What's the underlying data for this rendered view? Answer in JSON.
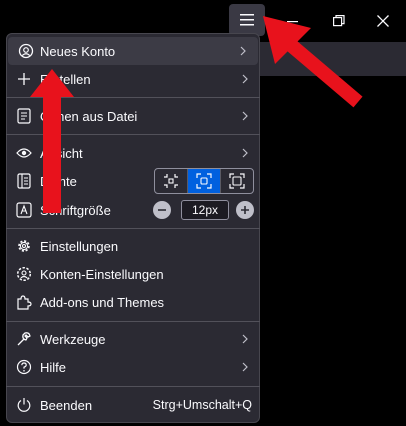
{
  "menu": {
    "new_account": {
      "label": "Neues Konto",
      "icon": "new-account-icon"
    },
    "create": {
      "label": "Erstellen",
      "icon": "plus-icon"
    },
    "open_file": {
      "label": "Öffnen aus Datei",
      "icon": "document-icon"
    },
    "view": {
      "label": "Ansicht",
      "icon": "eye-icon"
    },
    "density": {
      "label": "Dichte",
      "icon": "density-icon",
      "options": [
        "compact",
        "normal",
        "touch"
      ],
      "selected": "normal"
    },
    "font_size": {
      "label": "Schriftgröße",
      "icon": "font-size-icon",
      "value": "12px"
    },
    "settings": {
      "label": "Einstellungen",
      "icon": "gear-icon"
    },
    "account_settings": {
      "label": "Konten-Einstellungen",
      "icon": "account-settings-icon"
    },
    "addons": {
      "label": "Add-ons und Themes",
      "icon": "puzzle-icon"
    },
    "tools": {
      "label": "Werkzeuge",
      "icon": "wrench-icon"
    },
    "help": {
      "label": "Hilfe",
      "icon": "help-icon"
    },
    "quit": {
      "label": "Beenden",
      "icon": "power-icon",
      "shortcut": "Strg+Umschalt+Q"
    }
  },
  "colors": {
    "panel_bg": "#2b2a33",
    "highlight": "#3c3b45",
    "accent": "#0060df",
    "annotation_arrow": "#e8121c"
  }
}
